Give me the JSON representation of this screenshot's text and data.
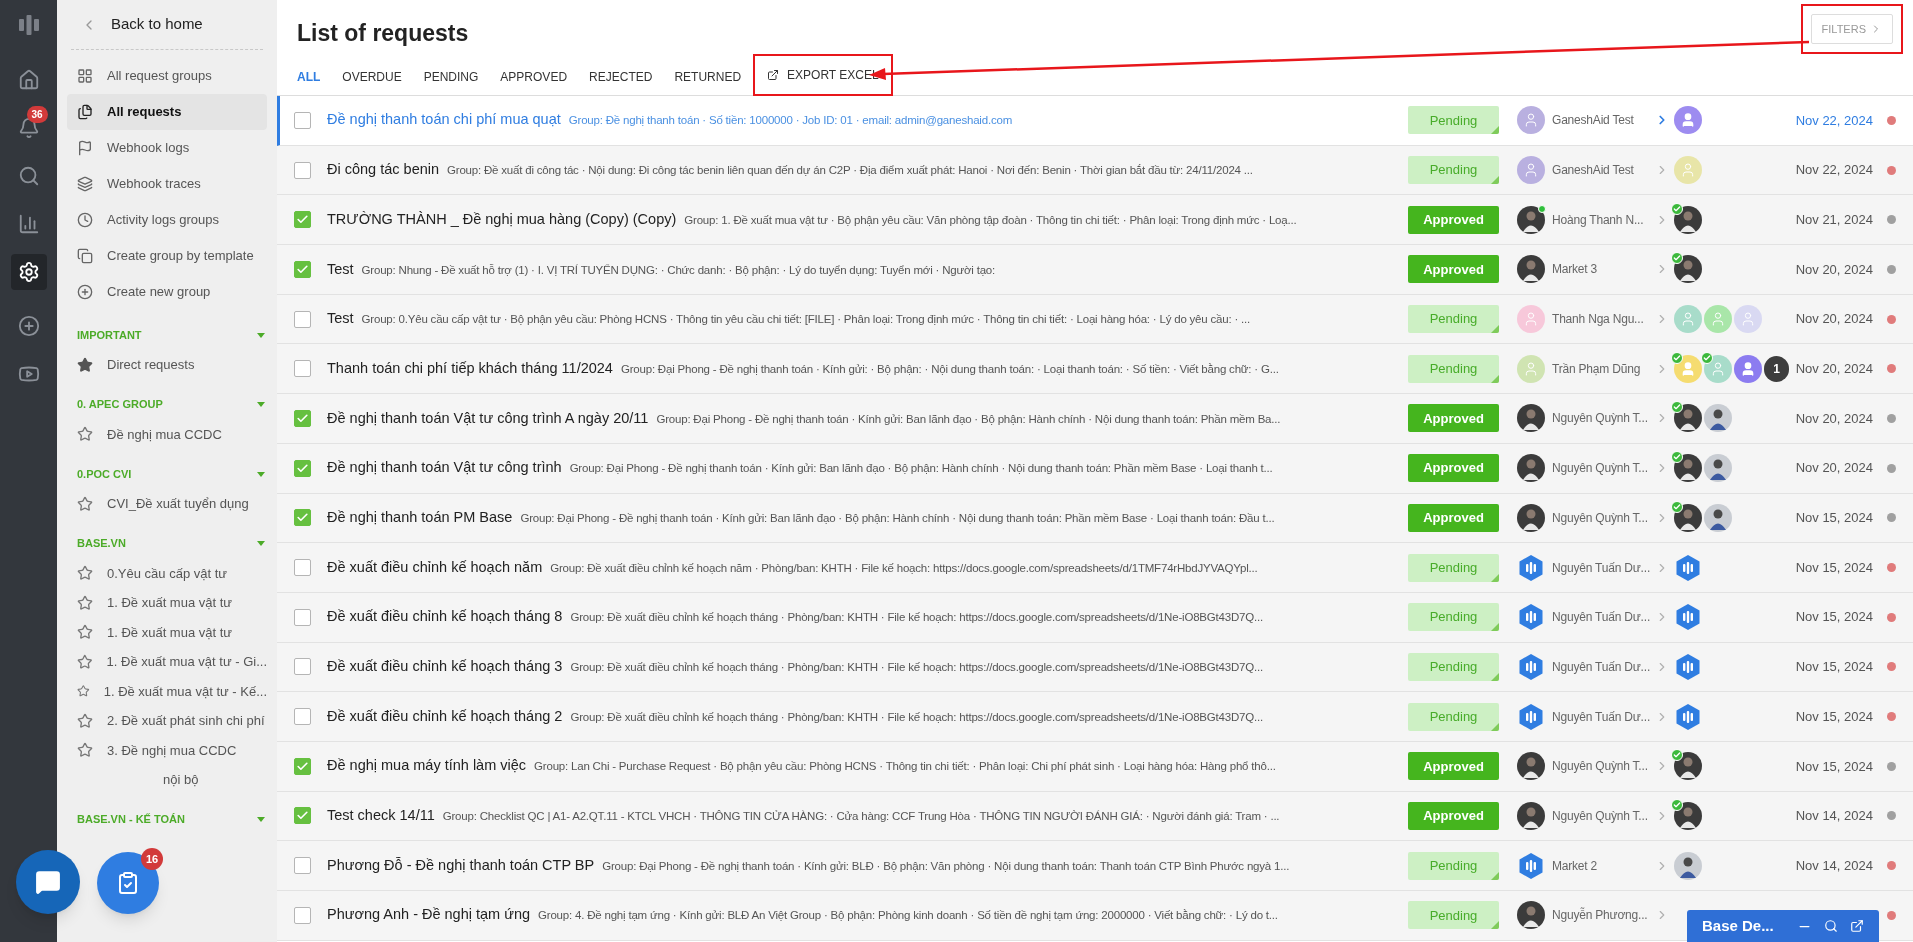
{
  "rail": {
    "items": [
      {
        "selected": false
      },
      {
        "selected": false,
        "badge": "36"
      },
      {
        "selected": false
      },
      {
        "selected": false
      },
      {
        "selected": true
      },
      {
        "selected": false
      },
      {
        "selected": false
      }
    ]
  },
  "sidebar": {
    "back": "Back to home",
    "nav": [
      {
        "label": "All request groups",
        "selected": false
      },
      {
        "label": "All requests",
        "selected": true
      },
      {
        "label": "Webhook logs",
        "selected": false
      },
      {
        "label": "Webhook traces",
        "selected": false
      },
      {
        "label": "Activity logs groups",
        "selected": false
      },
      {
        "label": "Create group by template",
        "selected": false
      },
      {
        "label": "Create new group",
        "selected": false
      }
    ],
    "sections": [
      {
        "title": "IMPORTANT",
        "items": [
          {
            "label": "Direct requests",
            "starred": true,
            "covered": false
          }
        ]
      },
      {
        "title": "0. APEC GROUP",
        "items": [
          {
            "label": "Đề nghị mua CCDC",
            "starred": false,
            "covered": false
          }
        ]
      },
      {
        "title": "0.POC CVI",
        "items": [
          {
            "label": "CVI_Đề xuất tuyển dụng",
            "starred": false,
            "covered": false
          }
        ]
      },
      {
        "title": "BASE.VN",
        "items": [
          {
            "label": "0.Yêu cầu cấp vật tư",
            "starred": false,
            "covered": false
          },
          {
            "label": "1. Đề xuất mua vật tư",
            "starred": false,
            "covered": false
          },
          {
            "label": "1. Đề xuất mua vật tư",
            "starred": false,
            "covered": false
          },
          {
            "label": "1. Đề xuất mua vật tư - Gi...",
            "starred": false,
            "covered": false
          },
          {
            "label": "1. Đề xuất mua vật tư - Kế...",
            "starred": false,
            "covered": false
          },
          {
            "label": "2. Đề xuất phát sinh chi phí",
            "starred": false,
            "covered": false
          },
          {
            "label": "3. Đề nghị mua CCDC",
            "starred": false,
            "covered": false
          },
          {
            "label": "nội bộ",
            "covered": true
          }
        ]
      },
      {
        "title": "BASE.VN - KẾ TOÁN"
      }
    ]
  },
  "floating": {
    "task_badge": "16"
  },
  "header": {
    "title": "List of requests",
    "filters": "FILTERS"
  },
  "tabs": [
    {
      "label": "ALL",
      "selected": true
    },
    {
      "label": "OVERDUE",
      "selected": false
    },
    {
      "label": "PENDING",
      "selected": false
    },
    {
      "label": "APPROVED",
      "selected": false
    },
    {
      "label": "REJECTED",
      "selected": false
    },
    {
      "label": "RETURNED",
      "selected": false
    }
  ],
  "export": {
    "label": "EXPORT EXCEL"
  },
  "rows": [
    {
      "selected": true,
      "checked": false,
      "title": "Đề nghị thanh toán chi phí mua quạt",
      "description": "Group: Đề nghị thanh toán · Số tiền: 1000000 · Job ID: 01 · email: admin@ganeshaid.com",
      "status": {
        "label": "Pending",
        "kind": "pending"
      },
      "creator": {
        "name": "GaneshAid Test",
        "kind": "placeholder",
        "color": "#b9b0e0",
        "online": false
      },
      "approvers": [
        {
          "kind": "filled",
          "color": "#9d8cf0",
          "approved": false
        }
      ],
      "date": "Nov 22, 2024",
      "color": "#e07b7b"
    },
    {
      "selected": false,
      "checked": false,
      "title": "Đi công tác benin",
      "description": "Group: Đề xuất đi công tác · Nội dung: Đi công tác benin liên quan đến dự án C2P · Địa điểm xuất phát: Hanoi · Nơi đến: Benin · Thời gian bắt đầu từ: 24/11/2024 ...",
      "status": {
        "label": "Pending",
        "kind": "pending"
      },
      "creator": {
        "name": "GaneshAid Test",
        "kind": "placeholder",
        "color": "#b9b0e0",
        "online": false
      },
      "approvers": [
        {
          "kind": "placeholder",
          "color": "#e8e5a8",
          "approved": false
        }
      ],
      "date": "Nov 22, 2024",
      "color": "#e07b7b"
    },
    {
      "selected": false,
      "checked": true,
      "title": "TRƯỜNG THÀNH _ Đề nghị mua hàng (Copy) (Copy)",
      "description": "Group: 1. Đề xuất mua vật tư · Bộ phận yêu cầu: Văn phòng tập đoàn · Thông tin chi tiết: · Phân loại: Trong định mức · Loạ...",
      "status": {
        "label": "Approved",
        "kind": "approved"
      },
      "creator": {
        "name": "Hoàng Thanh N...",
        "kind": "person",
        "online": true
      },
      "approvers": [
        {
          "kind": "person",
          "approved": true
        }
      ],
      "date": "Nov 21, 2024",
      "color": "#a0a0a0"
    },
    {
      "selected": false,
      "checked": true,
      "title": "Test",
      "description": "Group: Nhung - Đề xuất hỗ trợ (1) · I. VỊ TRÍ TUYỂN DỤNG: · Chức danh: · Bộ phận: · Lý do tuyển dụng: Tuyển mới · Người tạo:",
      "status": {
        "label": "Approved",
        "kind": "approved"
      },
      "creator": {
        "name": "Market 3",
        "kind": "person",
        "online": false
      },
      "approvers": [
        {
          "kind": "person",
          "approved": true
        }
      ],
      "date": "Nov 20, 2024",
      "color": "#a0a0a0"
    },
    {
      "selected": false,
      "checked": false,
      "title": "Test",
      "description": "Group: 0.Yêu cầu cấp vật tư · Bộ phận yêu cầu: Phòng HCNS · Thông tin yêu cầu chi tiết: [FILE] · Phân loại: Trong định mức · Thông tin chi tiết: · Loại hàng hóa: · Lý do yêu cầu: · ...",
      "status": {
        "label": "Pending",
        "kind": "pending"
      },
      "creator": {
        "name": "Thanh Nga Ngu...",
        "kind": "placeholder",
        "color": "#f7c8da",
        "online": false
      },
      "approvers": [
        {
          "kind": "placeholder",
          "color": "#a8dcca",
          "approved": false
        },
        {
          "kind": "placeholder",
          "color": "#a9e6a9",
          "approved": false
        },
        {
          "kind": "placeholder",
          "color": "#d9d9f2",
          "approved": false
        }
      ],
      "date": "Nov 20, 2024",
      "color": "#e07b7b"
    },
    {
      "selected": false,
      "checked": false,
      "title": "Thanh toán chi phí tiếp khách tháng 11/2024",
      "description": "Group: Đại Phong - Đề nghị thanh toán · Kính gửi: · Bộ phận: · Nội dung thanh toán: · Loại thanh toán: · Số tiền: · Viết bằng chữ: · G...",
      "status": {
        "label": "Pending",
        "kind": "pending"
      },
      "creator": {
        "name": "Trần Phạm Dũng",
        "kind": "placeholder",
        "color": "#d0e4b2",
        "online": false
      },
      "approvers": [
        {
          "kind": "filled",
          "color": "#f5dc70",
          "approved": true
        },
        {
          "kind": "placeholder",
          "color": "#a8dcca",
          "approved": true
        },
        {
          "kind": "filled",
          "color": "#8c7cf0",
          "approved": false
        }
      ],
      "more": "1",
      "date": "Nov 20, 2024",
      "color": "#e07b7b"
    },
    {
      "selected": false,
      "checked": true,
      "title": "Đề nghị thanh toán Vật tư công trình A ngày 20/11",
      "description": "Group: Đại Phong - Đề nghị thanh toán · Kính gửi: Ban lãnh đạo · Bộ phận: Hành chính · Nội dung thanh toán: Phần mềm Ba...",
      "status": {
        "label": "Approved",
        "kind": "approved"
      },
      "creator": {
        "name": "Nguyên Quỳnh T...",
        "kind": "person",
        "online": false
      },
      "approvers": [
        {
          "kind": "person",
          "approved": true
        },
        {
          "kind": "light",
          "approved": false
        }
      ],
      "date": "Nov 20, 2024",
      "color": "#a0a0a0"
    },
    {
      "selected": false,
      "checked": true,
      "title": "Đề nghị thanh toán Vật tư công trình",
      "description": "Group: Đại Phong - Đề nghị thanh toán · Kính gửi: Ban lãnh đạo · Bộ phận: Hành chính · Nội dung thanh toán: Phần mềm Base · Loại thanh t...",
      "status": {
        "label": "Approved",
        "kind": "approved"
      },
      "creator": {
        "name": "Nguyên Quỳnh T...",
        "kind": "person",
        "online": false
      },
      "approvers": [
        {
          "kind": "person",
          "approved": true
        },
        {
          "kind": "light",
          "approved": false
        }
      ],
      "date": "Nov 20, 2024",
      "color": "#a0a0a0"
    },
    {
      "selected": false,
      "checked": true,
      "title": "Đề nghị thanh toán PM Base",
      "description": "Group: Đại Phong - Đề nghị thanh toán · Kính gửi: Ban lãnh đạo · Bộ phận: Hành chính · Nội dung thanh toán: Phần mềm Base · Loại thanh toán: Đầu t...",
      "status": {
        "label": "Approved",
        "kind": "approved"
      },
      "creator": {
        "name": "Nguyên Quỳnh T...",
        "kind": "person",
        "online": false
      },
      "approvers": [
        {
          "kind": "person",
          "approved": true
        },
        {
          "kind": "light",
          "approved": false
        }
      ],
      "date": "Nov 15, 2024",
      "color": "#a0a0a0"
    },
    {
      "selected": false,
      "checked": false,
      "title": "Đề xuất điều chỉnh kế hoạch năm",
      "description": "Group: Đề xuất điều chỉnh kế hoạch năm · Phòng/ban: KHTH · File kế hoạch: https://docs.google.com/spreadsheets/d/1TMF74rHbdJYVAQYpl...",
      "status": {
        "label": "Pending",
        "kind": "pending"
      },
      "creator": {
        "name": "Nguyên Tuấn Dư...",
        "kind": "logo",
        "online": false
      },
      "approvers": [
        {
          "kind": "logo",
          "approved": false
        }
      ],
      "date": "Nov 15, 2024",
      "color": "#e07b7b"
    },
    {
      "selected": false,
      "checked": false,
      "title": "Đề xuất điều chỉnh kế hoạch tháng 8",
      "description": "Group: Đề xuất điều chỉnh kế hoạch tháng · Phòng/ban: KHTH · File kế hoạch: https://docs.google.com/spreadsheets/d/1Ne-iO8BGt43D7Q...",
      "status": {
        "label": "Pending",
        "kind": "pending"
      },
      "creator": {
        "name": "Nguyên Tuấn Dư...",
        "kind": "logo",
        "online": false
      },
      "approvers": [
        {
          "kind": "logo",
          "approved": false
        }
      ],
      "date": "Nov 15, 2024",
      "color": "#e07b7b"
    },
    {
      "selected": false,
      "checked": false,
      "title": "Đề xuất điều chỉnh kế hoạch tháng 3",
      "description": "Group: Đề xuất điều chỉnh kế hoạch tháng · Phòng/ban: KHTH · File kế hoạch: https://docs.google.com/spreadsheets/d/1Ne-iO8BGt43D7Q...",
      "status": {
        "label": "Pending",
        "kind": "pending"
      },
      "creator": {
        "name": "Nguyên Tuấn Dư...",
        "kind": "logo",
        "online": false
      },
      "approvers": [
        {
          "kind": "logo",
          "approved": false
        }
      ],
      "date": "Nov 15, 2024",
      "color": "#e07b7b"
    },
    {
      "selected": false,
      "checked": false,
      "title": "Đề xuất điều chỉnh kế hoạch tháng 2",
      "description": "Group: Đề xuất điều chỉnh kế hoạch tháng · Phòng/ban: KHTH · File kế hoạch: https://docs.google.com/spreadsheets/d/1Ne-iO8BGt43D7Q...",
      "status": {
        "label": "Pending",
        "kind": "pending"
      },
      "creator": {
        "name": "Nguyên Tuấn Dư...",
        "kind": "logo",
        "online": false
      },
      "approvers": [
        {
          "kind": "logo",
          "approved": false
        }
      ],
      "date": "Nov 15, 2024",
      "color": "#e07b7b"
    },
    {
      "selected": false,
      "checked": true,
      "title": "Đề nghị mua máy tính làm việc",
      "description": "Group: Lan Chi - Purchase Request · Bộ phận yêu cầu: Phòng HCNS · Thông tin chi tiết: · Phân loại: Chi phí phát sinh · Loại hàng hóa: Hàng phổ thô...",
      "status": {
        "label": "Approved",
        "kind": "approved"
      },
      "creator": {
        "name": "Nguyên Quỳnh T...",
        "kind": "person",
        "online": false
      },
      "approvers": [
        {
          "kind": "person",
          "approved": true
        }
      ],
      "date": "Nov 15, 2024",
      "color": "#a0a0a0"
    },
    {
      "selected": false,
      "checked": true,
      "title": "Test check 14/11",
      "description": "Group: Checklist QC | A1- A2.QT.11 - KTCL VHCH · THÔNG TIN CỬA HÀNG: · Cửa hàng: CCF Trung Hòa · THÔNG TIN NGƯỜI ĐÁNH GIÁ: · Người đánh giá: Tram · ...",
      "status": {
        "label": "Approved",
        "kind": "approved"
      },
      "creator": {
        "name": "Nguyên Quỳnh T...",
        "kind": "person",
        "online": false
      },
      "approvers": [
        {
          "kind": "person",
          "approved": true
        }
      ],
      "date": "Nov 14, 2024",
      "color": "#a0a0a0"
    },
    {
      "selected": false,
      "checked": false,
      "title": "Phương Đỗ - Đề nghị thanh toán CTP BP",
      "description": "Group: Đại Phong - Đề nghị thanh toán · Kính gửi: BLĐ · Bộ phận: Văn phòng · Nội dung thanh toán: Thanh toán CTP Bình Phước ngyà 1...",
      "status": {
        "label": "Pending",
        "kind": "pending"
      },
      "creator": {
        "name": "Market 2",
        "kind": "logo",
        "online": false
      },
      "approvers": [
        {
          "kind": "light",
          "approved": false
        }
      ],
      "date": "Nov 14, 2024",
      "color": "#e07b7b"
    },
    {
      "selected": false,
      "checked": false,
      "title": "Phương Anh - Đề nghị tạm ứng",
      "description": "Group: 4. Đề nghị tạm ứng · Kính gửi: BLĐ An Việt Group · Bộ phận: Phòng kinh doanh · Số tiền đề nghị tạm ứng: 2000000 · Viết bằng chữ: · Lý do t...",
      "status": {
        "label": "Pending",
        "kind": "pending"
      },
      "creator": {
        "name": "Nguyễn Phương...",
        "kind": "person",
        "online": false
      },
      "color": "#e07b7b"
    }
  ],
  "chat_widget": {
    "title": "Base De..."
  }
}
